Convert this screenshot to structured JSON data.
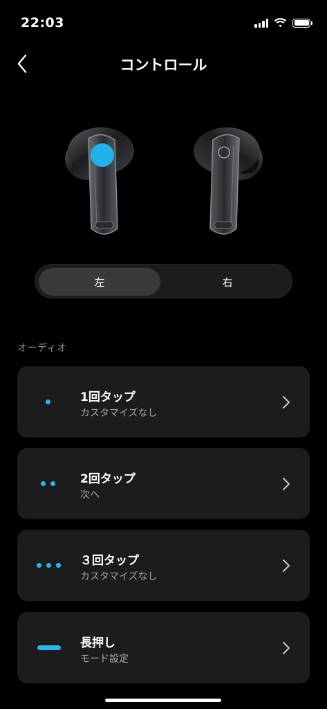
{
  "status_bar": {
    "time": "22:03",
    "signal_icon": "cellular-signal-icon",
    "wifi_icon": "wifi-icon",
    "battery_icon": "battery-icon",
    "battery_level": 1.0
  },
  "nav": {
    "back_icon": "chevron-left-icon",
    "title": "コントロール"
  },
  "earbuds": {
    "left_selected": true,
    "tap_area_color": "#1fb3ee"
  },
  "side_selector": {
    "left_label": "左",
    "right_label": "右",
    "selected": "左"
  },
  "section": {
    "label": "オーディオ"
  },
  "controls": [
    {
      "title": "1回タップ",
      "subtitle": "カスタマイズなし",
      "icon": "single-dot-icon"
    },
    {
      "title": "2回タップ",
      "subtitle": "次へ",
      "icon": "double-dot-icon"
    },
    {
      "title": "３回タップ",
      "subtitle": "カスタマイズなし",
      "icon": "triple-dot-icon"
    },
    {
      "title": "長押し",
      "subtitle": "モード設定",
      "icon": "long-press-bar-icon"
    }
  ],
  "colors": {
    "accent": "#29b7f0",
    "card_bg": "#1c1c1e",
    "background": "#000000"
  }
}
